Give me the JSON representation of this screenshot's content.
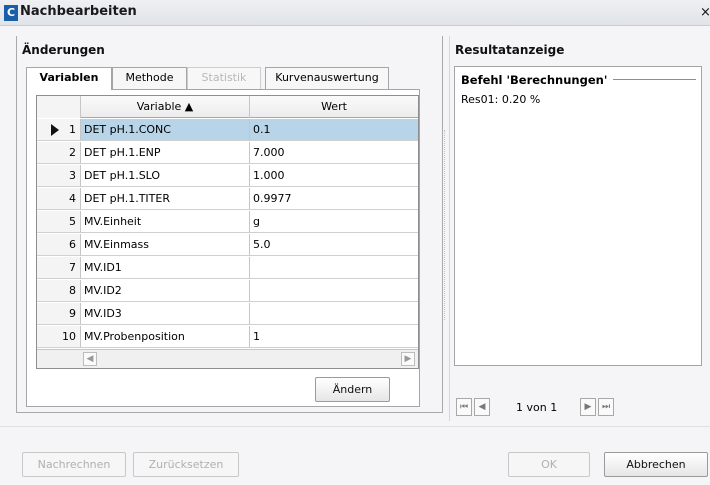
{
  "window": {
    "title": "Nachbearbeiten",
    "close": "×"
  },
  "left": {
    "title": "Änderungen",
    "tabs": [
      {
        "label": "Variablen",
        "state": "active"
      },
      {
        "label": "Methode",
        "state": "normal"
      },
      {
        "label": "Statistik",
        "state": "disabled"
      },
      {
        "label": "Kurvenauswertung",
        "state": "normal"
      }
    ],
    "grid": {
      "columns": [
        "Variable ▲",
        "Wert"
      ],
      "rows": [
        {
          "idx": "1",
          "variable": "DET pH.1.CONC",
          "value": "0.1",
          "selected": true
        },
        {
          "idx": "2",
          "variable": "DET pH.1.ENP",
          "value": "7.000"
        },
        {
          "idx": "3",
          "variable": "DET pH.1.SLO",
          "value": "1.000"
        },
        {
          "idx": "4",
          "variable": "DET pH.1.TITER",
          "value": "0.9977"
        },
        {
          "idx": "5",
          "variable": "MV.Einheit",
          "value": "g"
        },
        {
          "idx": "6",
          "variable": "MV.Einmass",
          "value": "5.0"
        },
        {
          "idx": "7",
          "variable": "MV.ID1",
          "value": ""
        },
        {
          "idx": "8",
          "variable": "MV.ID2",
          "value": ""
        },
        {
          "idx": "9",
          "variable": "MV.ID3",
          "value": ""
        },
        {
          "idx": "10",
          "variable": "MV.Probenposition",
          "value": "1"
        }
      ]
    },
    "change_button": "Ändern"
  },
  "right": {
    "title": "Resultatanzeige",
    "command": "Befehl 'Berechnungen'",
    "result": "Res01:  0.20 %",
    "pager": {
      "label": "1 von 1"
    }
  },
  "footer": {
    "recalc": "Nachrechnen",
    "reset": "Zurücksetzen",
    "ok": "OK",
    "cancel": "Abbrechen"
  },
  "colors": {
    "selection": "#b8d4e8",
    "brand": "#1b5ea8"
  }
}
